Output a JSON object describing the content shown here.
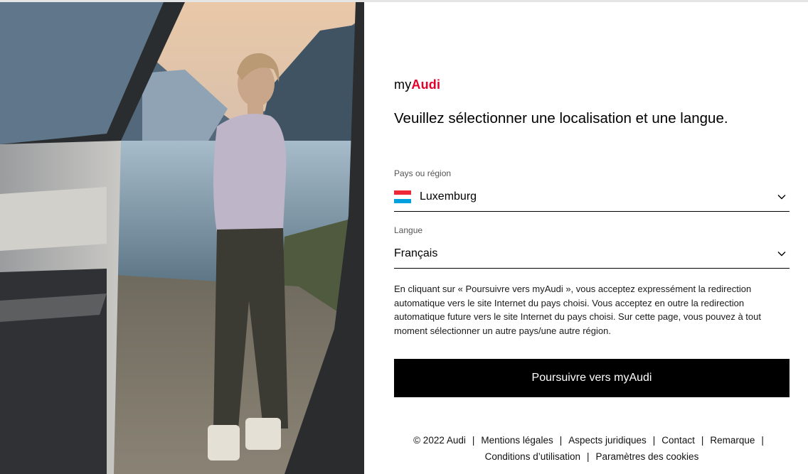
{
  "logo": {
    "prefix": "my",
    "brand": "Audi"
  },
  "headline": "Veuillez sélectionner une localisation et une langue.",
  "country": {
    "label": "Pays ou région",
    "value": "Luxemburg",
    "flag_colors": [
      "#ED2939",
      "#FFFFFF",
      "#00A1DE"
    ]
  },
  "language": {
    "label": "Langue",
    "value": "Français"
  },
  "consent_text": "En cliquant sur « Poursuivre vers myAudi », vous acceptez expressément la redirection automatique vers le site Internet du pays choisi. Vous acceptez en outre la redirection automatique future vers le site Internet du pays choisi. Sur cette page, vous pouvez à tout moment sélectionner un autre pays/une autre région.",
  "cta_label": "Poursuivre vers myAudi",
  "footer": {
    "copyright": "© 2022 Audi",
    "links": [
      "Mentions légales",
      "Aspects juridiques",
      "Contact",
      "Remarque",
      "Conditions d’utilisation",
      "Paramètres des cookies"
    ],
    "separator": "|"
  },
  "colors": {
    "brand_red": "#E4002B",
    "button_bg": "#000000"
  }
}
